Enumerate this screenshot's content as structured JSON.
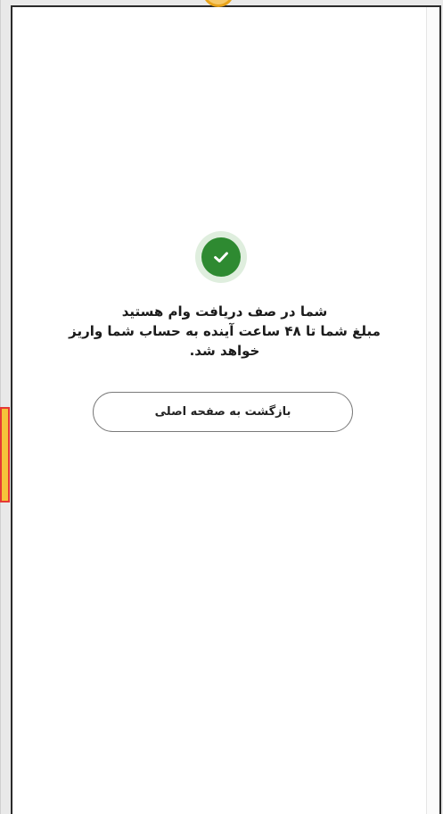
{
  "success": {
    "icon": "check-circle-icon",
    "accent_color": "#2e8a31",
    "ring_color": "#dfeede"
  },
  "message": {
    "line1": "شما در صف دریافت وام هستید",
    "line2": "مبلغ شما تا ۴۸ ساعت آینده به حساب شما واریز",
    "line3": "خواهد شد."
  },
  "actions": {
    "home_button_label": "بازگشت به صفحه اصلی"
  }
}
